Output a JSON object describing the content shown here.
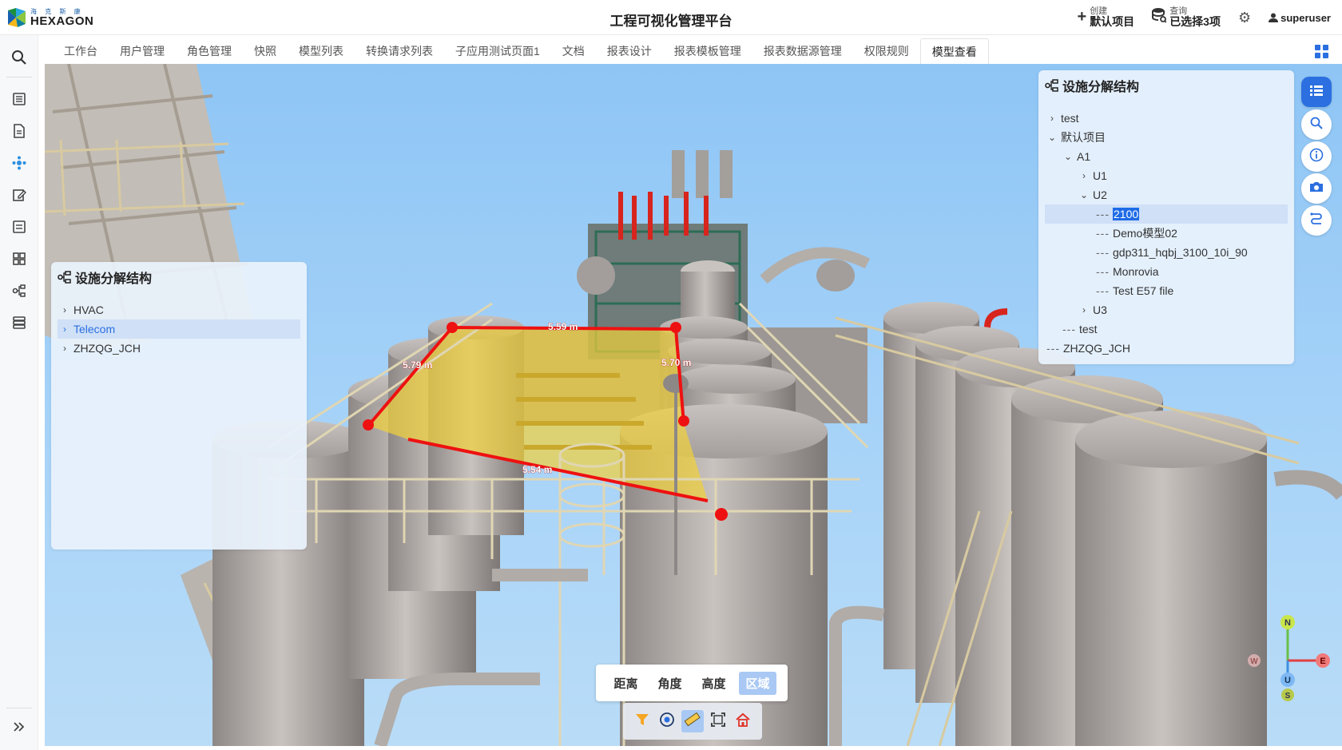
{
  "header": {
    "logo_cn": "海 克 斯 康",
    "logo_en": "HEXAGON",
    "title": "工程可视化管理平台",
    "create": {
      "small": "创建",
      "big": "默认项目"
    },
    "query": {
      "small": "查询",
      "big": "已选择3项"
    },
    "username": "superuser"
  },
  "tabs": [
    "工作台",
    "用户管理",
    "角色管理",
    "快照",
    "模型列表",
    "转换请求列表",
    "子应用测试页面1",
    "文档",
    "报表设计",
    "报表模板管理",
    "报表数据源管理",
    "权限规则",
    "模型查看"
  ],
  "active_tab": "模型查看",
  "left_panel": {
    "title": "设施分解结构",
    "items": [
      "HVAC",
      "Telecom",
      "ZHZQG_JCH"
    ],
    "selected": "Telecom"
  },
  "right_panel": {
    "title": "设施分解结构",
    "nodes": [
      {
        "label": "test",
        "prefix": ">"
      },
      {
        "label": "默认项目",
        "prefix": "v"
      },
      {
        "label": "A1",
        "prefix": "v"
      },
      {
        "label": "U1",
        "prefix": ">"
      },
      {
        "label": "U2",
        "prefix": "v"
      },
      {
        "label": "2100",
        "prefix": "---"
      },
      {
        "label": "Demo模型02",
        "prefix": "---"
      },
      {
        "label": "gdp311_hqbj_3100_10i_90",
        "prefix": "---"
      },
      {
        "label": "Monrovia",
        "prefix": "---"
      },
      {
        "label": "Test E57 file",
        "prefix": "---"
      },
      {
        "label": "U3",
        "prefix": ">"
      },
      {
        "label": "test",
        "prefix": "---"
      },
      {
        "label": "ZHZQG_JCH",
        "prefix": "---"
      }
    ],
    "selected": "2100"
  },
  "measure_modes": [
    "距离",
    "角度",
    "高度",
    "区域"
  ],
  "active_measure": "区域",
  "measurements": [
    "5.59 m",
    "5.79 m",
    "5.70 m",
    "5.54 m"
  ],
  "compass": {
    "n": "N",
    "e": "E",
    "s": "S",
    "u": "U",
    "w": "W"
  },
  "colors": {
    "accent": "#2b6fe0",
    "area_fill": "#f2d23a",
    "measure_line": "#ee1111",
    "sky": "#9fcdf7"
  },
  "rail_icons": [
    "search-icon",
    "list-icon",
    "document-icon",
    "model-icon",
    "edit-icon",
    "report-icon",
    "apps-icon",
    "tree-icon",
    "database-icon",
    "expand-icon"
  ],
  "fab_icons": [
    "list-icon",
    "search-icon",
    "info-icon",
    "camera-icon",
    "route-icon"
  ],
  "toolbar_icons": [
    "filter-icon",
    "view-icon",
    "ruler-icon",
    "fit-icon",
    "home-icon"
  ]
}
